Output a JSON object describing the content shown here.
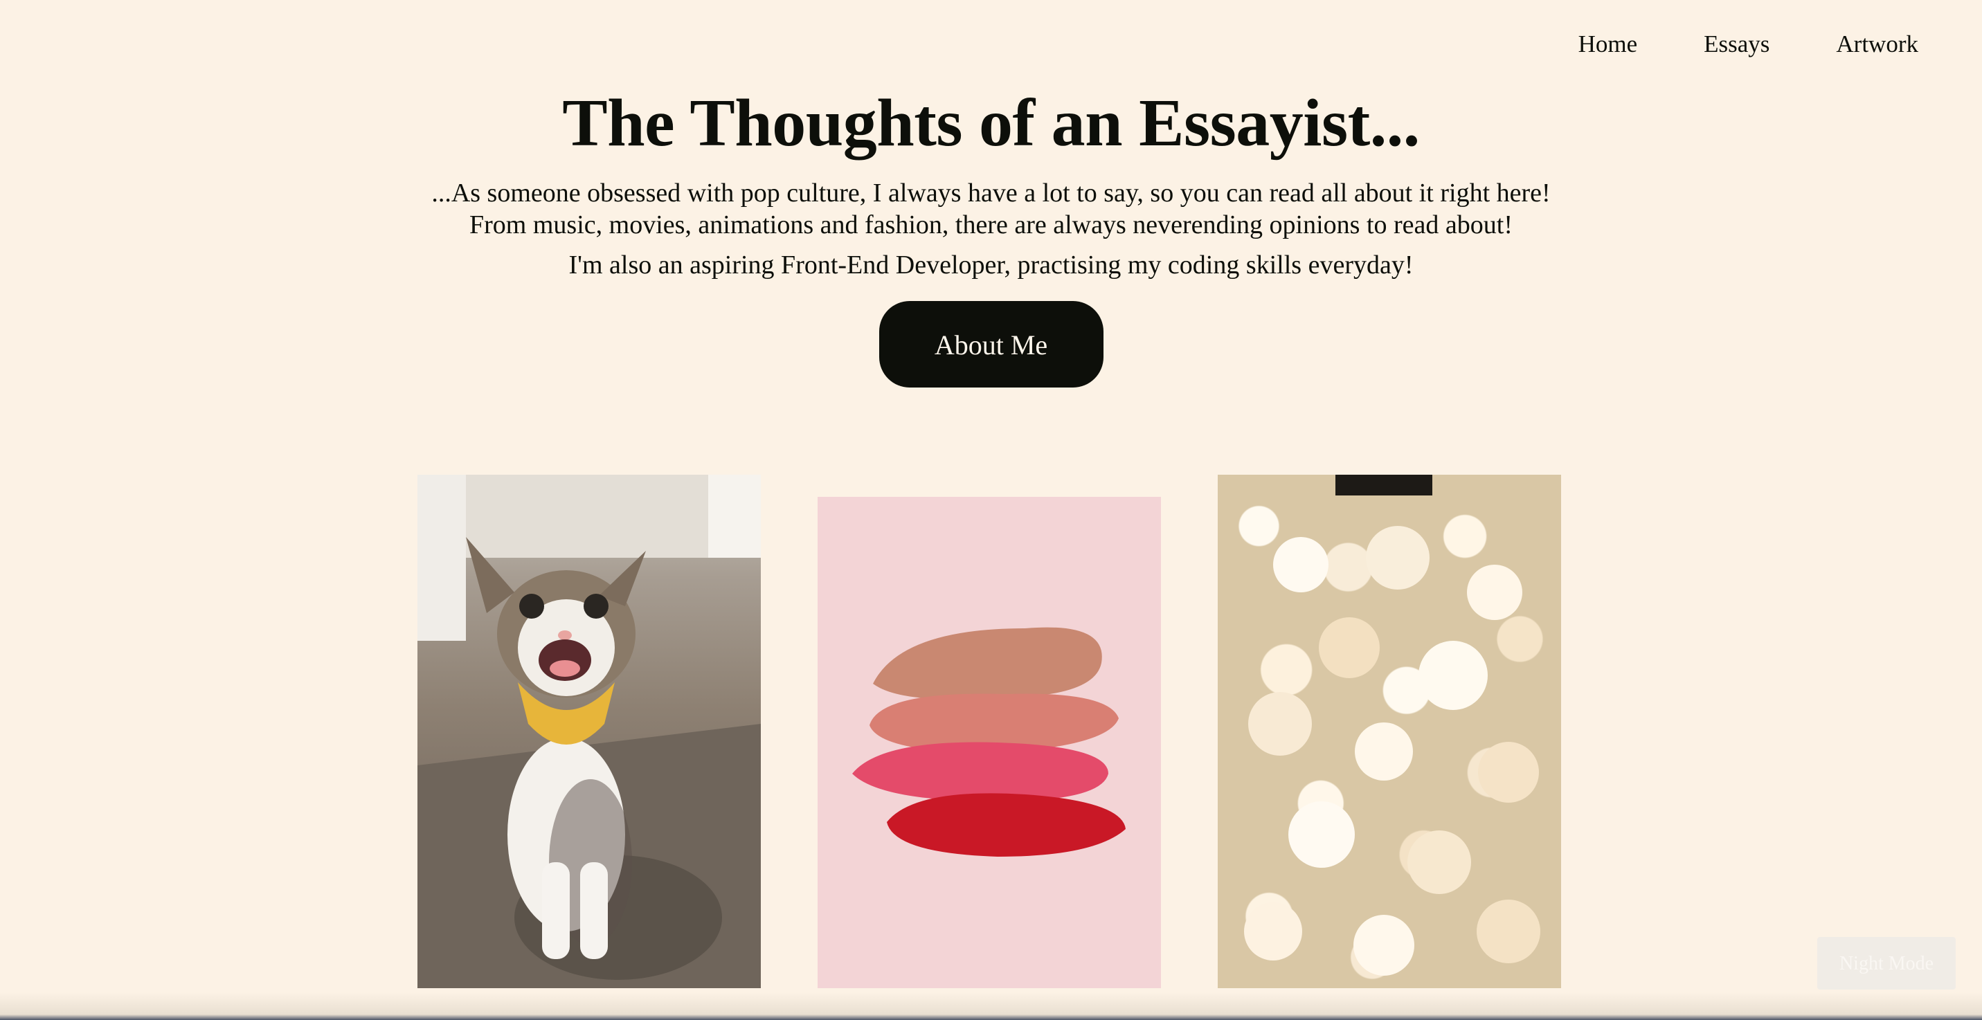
{
  "nav": {
    "items": [
      {
        "label": "Home"
      },
      {
        "label": "Essays"
      },
      {
        "label": "Artwork"
      }
    ]
  },
  "hero": {
    "title": "The Thoughts of an Essayist...",
    "intro": "...As someone obsessed with pop culture, I always have a lot to say, so you can read all about it right here! From music, movies, animations and fashion, there are always neverending opinions to read about!",
    "dev_note": "I'm also an aspiring Front-End Developer, practising my coding skills everyday!",
    "about_button": "About Me"
  },
  "night_mode_button": "Night Mode",
  "colors": {
    "background": "#fcf2e5",
    "text": "#0d0f0a",
    "button_bg": "#0d0f0a",
    "button_text": "#fdf6ec"
  }
}
